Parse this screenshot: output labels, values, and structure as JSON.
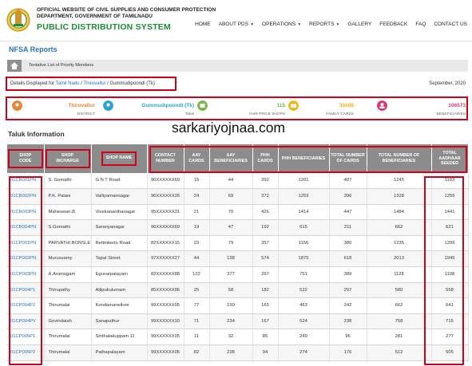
{
  "header": {
    "org_line1": "OFFICIAL WEBSITE OF CIVIL SUPPLIES AND CONSUMER PROTECTION",
    "org_line2": "DEPARTMENT, GOVERNMENT OF TAMILNADU",
    "title": "PUBLIC DISTRIBUTION SYSTEM",
    "nav": [
      {
        "label": "HOME",
        "dropdown": false
      },
      {
        "label": "ABOUT PDS",
        "dropdown": true
      },
      {
        "label": "OPERATIONS",
        "dropdown": true
      },
      {
        "label": "REPORTS",
        "dropdown": true
      },
      {
        "label": "GALLERY",
        "dropdown": false
      },
      {
        "label": "FEEDBACK",
        "dropdown": false
      },
      {
        "label": "FAQ",
        "dropdown": false
      },
      {
        "label": "CONTACT US",
        "dropdown": false
      }
    ]
  },
  "page": {
    "section_title": "NFSA Reports",
    "breadcrumb": "Tentative List of Priority Members",
    "details_prefix": "Details Displayed for",
    "state": "Tamil Nadu",
    "district": "Thiruvallur",
    "taluk": "Gummudipoondi (Tk)",
    "month": "September, 2020",
    "watermark": "sarkariyojnaa.com",
    "taluk_info_title": "Taluk Information"
  },
  "summary": [
    {
      "value": "Thiruvallur",
      "label": "DISTRICT",
      "color": "#e8873a",
      "icon": "map-pin-icon"
    },
    {
      "value": "Gummudipoondi (Tk)",
      "label": "Taluk",
      "color": "#2aa6c8",
      "icon": "location-icon"
    },
    {
      "value": "115",
      "label": "FAIR PRICE SHOPS",
      "color": "#7ab648",
      "icon": "shop-icon"
    },
    {
      "value": "36608",
      "label": "FAMILY CARDS",
      "color": "#f2b619",
      "icon": "card-icon"
    },
    {
      "value": "106573",
      "label": "BENEFICIARIES",
      "color": "#d9376e",
      "icon": "people-icon"
    }
  ],
  "table": {
    "headers": [
      "SHOP CODE",
      "SHOP INCHARGE",
      "SHOP NAME",
      "CONTACT NUMBER",
      "AAY CARDS",
      "AAY BENEFICIARIES",
      "PHH CARDS",
      "PHH BENEFICIARIES",
      "TOTAL NUMBER OF CARDS",
      "TOTAL NUMBER OF BENEFICIARIES",
      "TOTAL AADHAAR SEEDED"
    ],
    "rows": [
      [
        "01CB001PN",
        "S. Gomathi",
        "G N T Road",
        "96XXXXXX69",
        "15",
        "44",
        "392",
        "1201",
        "407",
        "1245",
        "1193"
      ],
      [
        "01CB002PN",
        "P.K. Palani",
        "Valliyamannagar",
        "96XXXXXX26",
        "24",
        "69",
        "372",
        "1259",
        "396",
        "1328",
        "1255"
      ],
      [
        "01CB003PN",
        "Maheswari.B",
        "Vivekananthanagar",
        "95XXXXXX31",
        "21",
        "70",
        "426",
        "1414",
        "447",
        "1484",
        "1441"
      ],
      [
        "01CB004PN",
        "S.Gomathi",
        "Saranyanagar",
        "96XXXXXX69",
        "19",
        "47",
        "192",
        "615",
        "211",
        "662",
        "621"
      ],
      [
        "01CP001PN",
        "PARVATHI BONSLE",
        "Rettmbedu Road",
        "82XXXXXX15",
        "23",
        "79",
        "357",
        "1156",
        "380",
        "1235",
        "1206"
      ],
      [
        "01CP002PN",
        "Murusvamy",
        "Tapal Street",
        "97XXXXXX27",
        "44",
        "138",
        "574",
        "1875",
        "618",
        "2013",
        "1945"
      ],
      [
        "01CP003PN",
        "A.Arumugam",
        "Eguvarpalayam",
        "82XXXXXX88",
        "122",
        "377",
        "267",
        "751",
        "389",
        "1128",
        "1108"
      ],
      [
        "01CP004P1",
        "Thirupathy",
        "Allipukulumam",
        "85XXXXXX96",
        "25",
        "58",
        "182",
        "522",
        "207",
        "580",
        "558"
      ],
      [
        "01CP004P2",
        "Thirumalai",
        "Kondamanellore",
        "99XXXXXX05",
        "77",
        "199",
        "165",
        "463",
        "242",
        "662",
        "641"
      ],
      [
        "01CP004PV",
        "Govindaiah",
        "Sanaputhur",
        "99XXXXXX10",
        "71",
        "234",
        "167",
        "524",
        "238",
        "758",
        "715"
      ],
      [
        "01CP005P1",
        "Thirumalai",
        "Sinthalakuppam 11",
        "99XXXXXX05",
        "11",
        "32",
        "85",
        "249",
        "96",
        "281",
        "277"
      ],
      [
        "01CP005P2",
        "Thirumalai",
        "Pathapalayam",
        "99XXXXXX05",
        "82",
        "238",
        "94",
        "274",
        "176",
        "512",
        "505"
      ]
    ]
  }
}
